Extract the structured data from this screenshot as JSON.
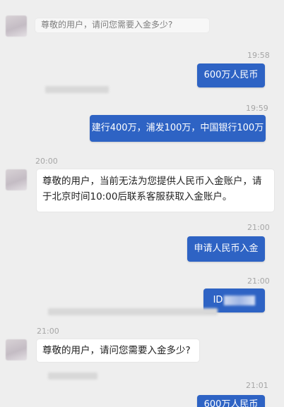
{
  "messages": {
    "m1": "尊敬的用户，请问您需要入金多少?",
    "t1": "19:58",
    "m2": "600万人民币",
    "t2": "19:59",
    "m3": "建行400万，浦发100万，中国银行100万",
    "t3": "20:00",
    "m4_line1": "尊敬的用户，当前无法为您提供人民币入金账户，请",
    "m4_line2": "于北京时间10:00后联系客服获取入金账户。",
    "t4": "21:00",
    "m5": "申请人民币入金",
    "t5": "21:00",
    "m6": "ID",
    "t6": "21:00",
    "m7": "尊敬的用户，请问您需要入金多少?",
    "t7": "21:01",
    "m8": "600万人民币"
  },
  "colors": {
    "background": "#eeeeee",
    "outgoing_bubble": "#2e63c4",
    "incoming_bubble": "#ffffff"
  }
}
